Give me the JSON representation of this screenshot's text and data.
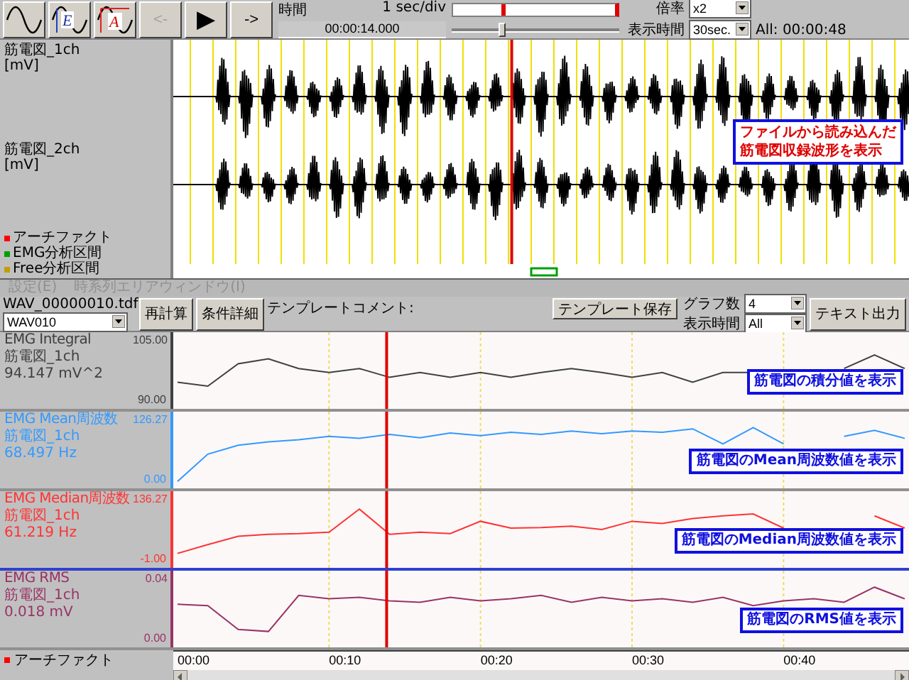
{
  "toolbar": {
    "tool_buttons": [
      {
        "kind": "wave"
      },
      {
        "kind": "wave_e",
        "letter": "E"
      },
      {
        "kind": "wave_a",
        "letter": "A"
      }
    ],
    "nav_buttons": [
      {
        "kind": "back",
        "label": "<-",
        "disabled": true
      },
      {
        "kind": "play",
        "label": "▶",
        "disabled": false
      },
      {
        "kind": "forward",
        "label": "->",
        "disabled": false
      }
    ],
    "time_label": "時間",
    "scale": "1 sec/div",
    "time_value": "00:00:14.000",
    "position_track": {
      "level": 0.3
    },
    "position_slider": {
      "level": 0.3
    },
    "zoom": {
      "label": "倍率",
      "value": "x2"
    },
    "display_time": {
      "label": "表示時間",
      "value": "30sec."
    },
    "total": "All: 00:00:48"
  },
  "waveform_panel": {
    "channels": [
      {
        "name": "筋電図_1ch",
        "unit": "[mV]"
      },
      {
        "name": "筋電図_2ch",
        "unit": "[mV]"
      }
    ],
    "legend": [
      {
        "label": "アーチファクト",
        "color": "#ff0000"
      },
      {
        "label": "EMG分析区間",
        "color": "#00a000"
      },
      {
        "label": "Free分析区間",
        "color": "#c0a000"
      }
    ],
    "cursor": {
      "level": 0.46
    },
    "callout_lines": [
      "ファイルから読み込んだ",
      "筋電図収録波形を表示"
    ]
  },
  "menu": [
    {
      "label": "設定(E)",
      "disabled": true
    },
    {
      "label": "時系列エリアウィンドウ(I)",
      "disabled": true
    }
  ],
  "controls": {
    "file_name": "WAV_00000010.tdf",
    "file_select": "WAV010",
    "buttons": [
      "再計算",
      "条件詳細"
    ],
    "comment_label": "テンプレートコメント:",
    "save_button": "テンプレート保存",
    "graph_count": {
      "label": "グラフ数",
      "value": "4"
    },
    "display_time": {
      "label": "表示時間",
      "value": "All"
    },
    "export_button": "テキスト出力"
  },
  "cursor": {
    "level": 0.29
  },
  "graphs": [
    {
      "label": "EMG Integral",
      "channel": "筋電図_1ch",
      "reading": "94.147 mV^2",
      "color": "#404040",
      "selected": false,
      "callout": "筋電図の積分値を表示",
      "axis_max": "105.00",
      "axis_min": "90.00"
    },
    {
      "label": "EMG Mean周波数",
      "channel": "筋電図_1ch",
      "reading": "68.497 Hz",
      "color": "#3399ff",
      "selected": false,
      "callout": "筋電図の**Mean**周波数値を表示",
      "axis_max": "126.27",
      "axis_min": "0.00"
    },
    {
      "label": "EMG Median周波数",
      "channel": "筋電図_1ch",
      "reading": "61.219 Hz",
      "color": "#ff3333",
      "selected": true,
      "callout": "筋電図の**Median**周波数値を表示",
      "axis_max": "136.27",
      "axis_min": "-1.00"
    },
    {
      "label": "EMG RMS",
      "channel": "筋電図_1ch",
      "reading": "0.018 mV",
      "color": "#993366",
      "selected": false,
      "callout": "筋電図の**RMS**値を表示",
      "axis_max": "0.04",
      "axis_min": "0.00"
    }
  ],
  "time_axis": [
    "00:00",
    "00:10",
    "00:20",
    "00:30",
    "00:40"
  ],
  "artifact_legend": {
    "label": "アーチファクト",
    "color": "#ff0000"
  }
}
